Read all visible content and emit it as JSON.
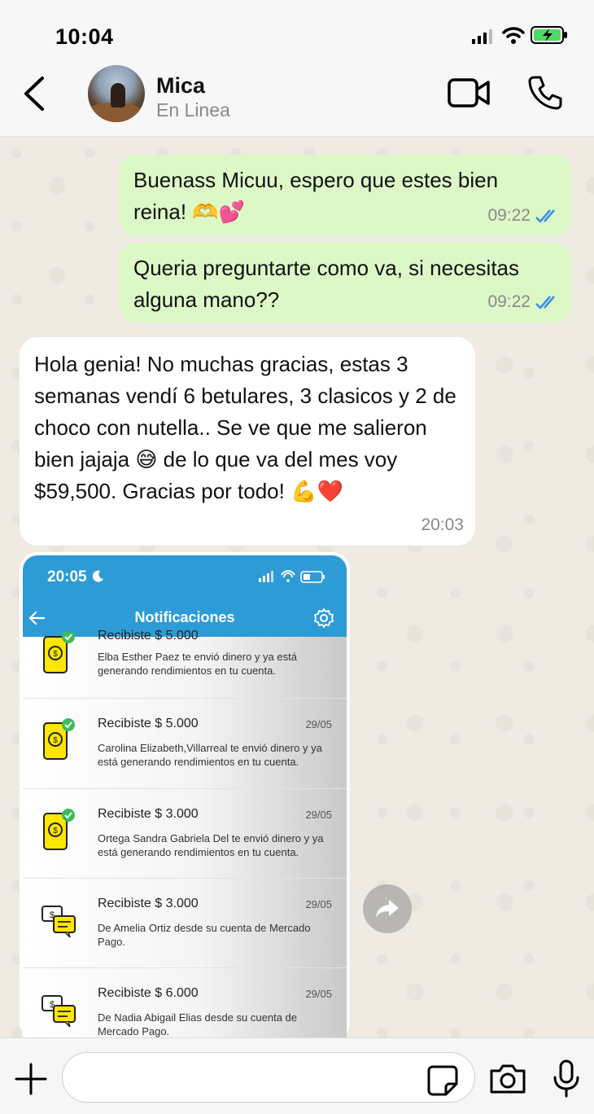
{
  "status_bar": {
    "time": "10:04"
  },
  "header": {
    "name": "Mica",
    "status": "En Linea"
  },
  "messages": [
    {
      "text": "Buenass Micuu, espero que estes bien reina! 🫶💕",
      "time": "09:22"
    },
    {
      "text": "Queria preguntarte como va, si necesitas alguna mano??",
      "time": "09:22"
    },
    {
      "text": "Hola genia! No muchas gracias, estas 3 semanas vendí 6 betulares, 3 clasicos y 2 de choco con nutella.. Se ve que me salieron bien jajaja 😅 de lo que va del mes voy $59,500. Gracias por todo! 💪❤️",
      "time": "20:03"
    }
  ],
  "screenshot": {
    "time": "20:05",
    "title": "Notificaciones",
    "notifications": [
      {
        "title": "Recibiste $ 5.000",
        "date": "",
        "body": "Elba Esther Paez te envió dinero y ya está generando rendimientos en tu cuenta.",
        "icon": "phone-coin-icon"
      },
      {
        "title": "Recibiste $ 5.000",
        "date": "29/05",
        "body": "Carolina Elizabeth,Villarreal te envió dinero y ya está generando rendimientos en tu cuenta.",
        "icon": "phone-coin-icon"
      },
      {
        "title": "Recibiste $ 3.000",
        "date": "29/05",
        "body": "Ortega Sandra Gabriela Del te envió dinero y ya está generando rendimientos en tu cuenta.",
        "icon": "phone-coin-icon"
      },
      {
        "title": "Recibiste $ 3.000",
        "date": "29/05",
        "body": "De Amelia Ortiz desde su cuenta de Mercado Pago.",
        "icon": "chat-money-icon"
      },
      {
        "title": "Recibiste $ 6.000",
        "date": "29/05",
        "body": "De Nadia Abigail Elias desde su cuenta de Mercado Pago.",
        "icon": "chat-money-icon"
      }
    ]
  },
  "input": {
    "placeholder": ""
  },
  "colors": {
    "outgoing": "#dcf8c6",
    "incoming": "#ffffff",
    "tick_blue": "#3a8ee6",
    "mp_blue": "#2d9bd6"
  }
}
